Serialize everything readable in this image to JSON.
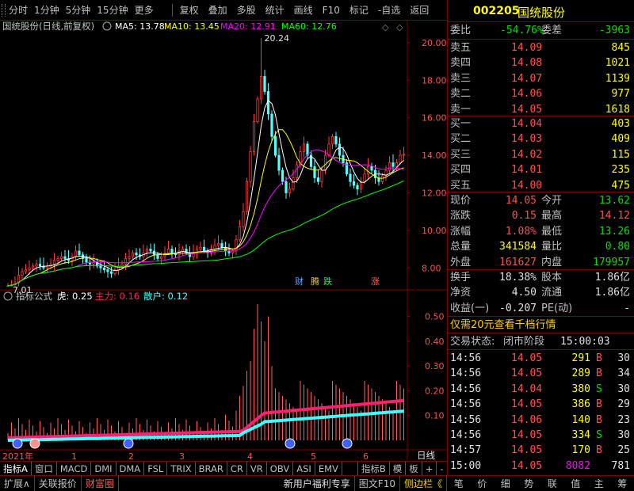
{
  "toolbar": {
    "items": [
      "分时",
      "1分钟",
      "5分钟",
      "15分钟",
      "更多",
      "复权",
      "叠加",
      "多股",
      "统计",
      "画线",
      "F10",
      "标记",
      "-自选",
      "返回"
    ]
  },
  "chart": {
    "title": "国统股份(日线,前复权)",
    "ma_labels": [
      {
        "text": "MA5: 13.78",
        "color": "#ffffff"
      },
      {
        "text": "MA10: 13.45",
        "color": "#ffff00"
      },
      {
        "text": "MA20: 12.91",
        "color": "#ff00ff"
      },
      {
        "text": "MA60: 12.76",
        "color": "#00ff00"
      }
    ],
    "price_ticks": [
      "20.00",
      "18.00",
      "16.00",
      "14.00",
      "12.00",
      "10.00",
      "8.00"
    ],
    "high_label": "20.24",
    "low_label": "7.01",
    "markers": [
      {
        "text": "财",
        "color": "#5fa8ff"
      },
      {
        "text": "腾",
        "color": "#ffcc00"
      },
      {
        "text": "跌",
        "color": "#00ff66"
      },
      {
        "text": "涨",
        "color": "#ff6666"
      }
    ],
    "indicator": {
      "name": "指标公式",
      "tiger": "虎: 0.25",
      "main": "主力: 0.16",
      "retail": "散户: 0.12"
    },
    "ind_ticks": [
      "0.50",
      "0.40",
      "0.30",
      "0.20",
      "0.10"
    ],
    "x_labels": [
      "2021年",
      "1",
      "2",
      "3",
      "4",
      "5",
      "6"
    ],
    "x_right_label": "日线"
  },
  "chart_data": {
    "type": "candlestick",
    "ylim": [
      7.0,
      20.5
    ],
    "ylabel_ticks": [
      8,
      10,
      12,
      14,
      16,
      18,
      20
    ],
    "ma_values": {
      "MA5": 13.78,
      "MA10": 13.45,
      "MA20": 12.91,
      "MA60": 12.76
    },
    "high": 20.24,
    "low": 7.01,
    "indicator_ylim": [
      0.0,
      0.55
    ],
    "indicator_values": {
      "tiger": 0.25,
      "main": 0.16,
      "retail": 0.12
    }
  },
  "tabs": {
    "items": [
      "指标A",
      "窗口",
      "MACD",
      "DMI",
      "DMA",
      "FSL",
      "TRIX",
      "BRAR",
      "CR",
      "VR",
      "OBV",
      "ASI",
      "EMV",
      "...",
      "指标B",
      "模",
      "板",
      "+",
      "-"
    ]
  },
  "statusbar": {
    "left1": "扩展∧",
    "left2": "关联报价",
    "left3": "财富圈",
    "mid1": "新用户福利专享",
    "mid2": "图文F10",
    "mid3": "侧边栏《",
    "icons": [
      "笔",
      "价",
      "细",
      "势",
      "联",
      "值",
      "主",
      "筹"
    ]
  },
  "quote": {
    "code": "002205",
    "name": "国统股份",
    "weibi_label": "委比",
    "weibi_value": "-54.76%",
    "weicha_label": "委差",
    "weicha_value": "-3963",
    "asks": [
      {
        "label": "卖五",
        "price": "14.09",
        "vol": "845"
      },
      {
        "label": "卖四",
        "price": "14.08",
        "vol": "1021"
      },
      {
        "label": "卖三",
        "price": "14.07",
        "vol": "1139"
      },
      {
        "label": "卖二",
        "price": "14.06",
        "vol": "977"
      },
      {
        "label": "卖一",
        "price": "14.05",
        "vol": "1618"
      }
    ],
    "bids": [
      {
        "label": "买一",
        "price": "14.04",
        "vol": "403"
      },
      {
        "label": "买二",
        "price": "14.03",
        "vol": "409"
      },
      {
        "label": "买三",
        "price": "14.02",
        "vol": "115"
      },
      {
        "label": "买四",
        "price": "14.01",
        "vol": "235"
      },
      {
        "label": "买五",
        "price": "14.00",
        "vol": "475"
      }
    ],
    "stats": [
      {
        "l1": "现价",
        "v1": "14.05",
        "c1": "red",
        "l2": "今开",
        "v2": "13.62",
        "c2": "green"
      },
      {
        "l1": "涨跌",
        "v1": "0.15",
        "c1": "red",
        "l2": "最高",
        "v2": "14.12",
        "c2": "red"
      },
      {
        "l1": "涨幅",
        "v1": "1.08%",
        "c1": "red",
        "l2": "最低",
        "v2": "13.26",
        "c2": "green"
      },
      {
        "l1": "总量",
        "v1": "341584",
        "c1": "yellow",
        "l2": "量比",
        "v2": "0.80",
        "c2": "green"
      },
      {
        "l1": "外盘",
        "v1": "161627",
        "c1": "red",
        "l2": "内盘",
        "v2": "179957",
        "c2": "green"
      }
    ],
    "stats2": [
      {
        "l1": "换手",
        "v1": "18.38%",
        "l2": "股本",
        "v2": "1.86亿"
      },
      {
        "l1": "净资",
        "v1": "4.50",
        "l2": "流通",
        "v2": "1.86亿"
      },
      {
        "l1": "收益(一)",
        "v1": "-0.207",
        "l2": "PE(动)",
        "v2": "-"
      }
    ],
    "promo": "仅需20元查看千档行情",
    "trade_status_label": "交易状态:",
    "trade_status_value": "闭市阶段",
    "trade_status_time": "15:00:03",
    "ticks": [
      {
        "t": "14:56",
        "p": "14.05",
        "v": "291",
        "s": "B",
        "n": "30"
      },
      {
        "t": "14:56",
        "p": "14.05",
        "v": "289",
        "s": "B",
        "n": "34"
      },
      {
        "t": "14:56",
        "p": "14.04",
        "v": "380",
        "s": "S",
        "n": "30"
      },
      {
        "t": "14:56",
        "p": "14.05",
        "v": "386",
        "s": "B",
        "n": "29"
      },
      {
        "t": "14:56",
        "p": "14.06",
        "v": "140",
        "s": "B",
        "n": "23"
      },
      {
        "t": "14:56",
        "p": "14.05",
        "v": "334",
        "s": "S",
        "n": "30"
      },
      {
        "t": "14:57",
        "p": "14.05",
        "v": "170",
        "s": "B",
        "n": "25"
      },
      {
        "t": "15:00",
        "p": "14.05",
        "v": "8082",
        "s": "",
        "n": "781"
      }
    ]
  }
}
